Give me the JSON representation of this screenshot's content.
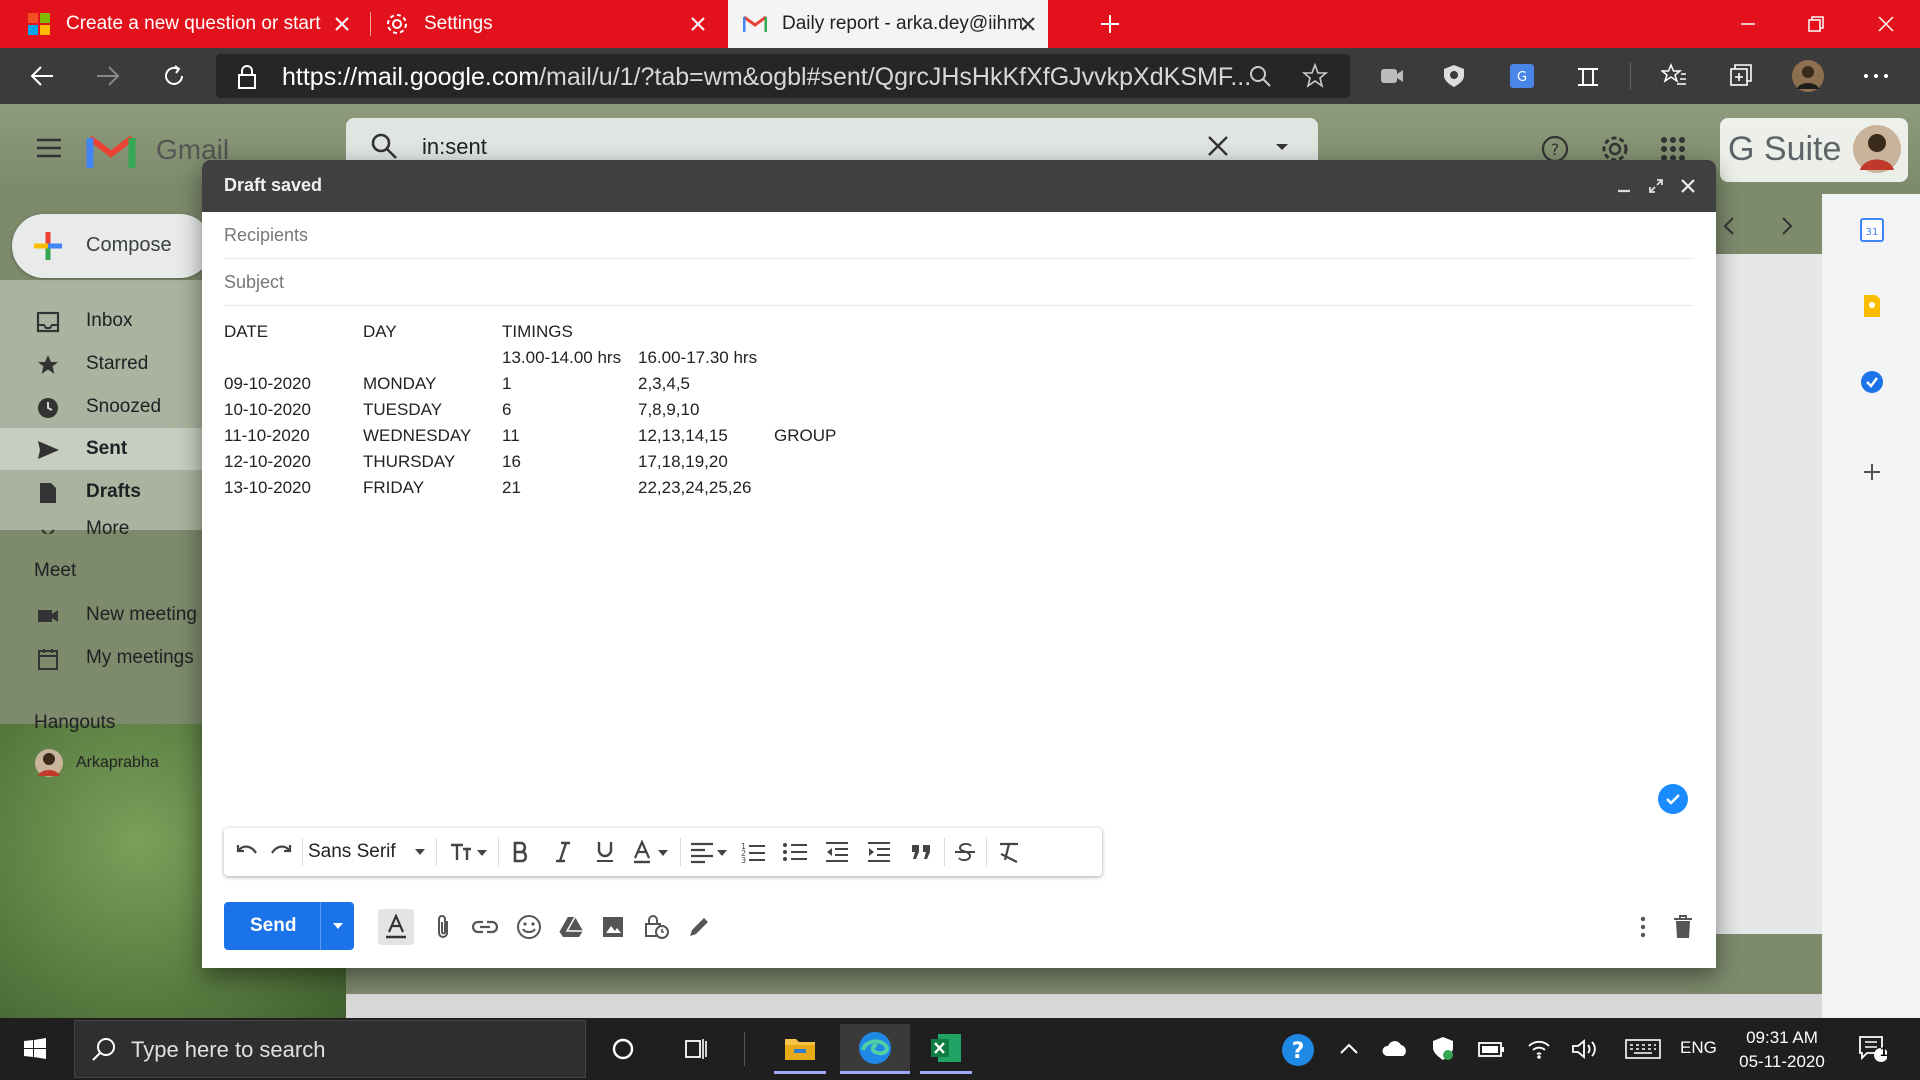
{
  "browser": {
    "tabs": [
      {
        "label": "Create a new question or start a",
        "icon": "microsoft-icon"
      },
      {
        "label": "Settings",
        "icon": "gear-icon"
      },
      {
        "label": "Daily report - arka.dey@iihm.ac.i",
        "icon": "gmail-icon",
        "active": true
      }
    ],
    "url_host": "https://mail.google.com",
    "url_path": "/mail/u/1/?tab=wm&ogbl#sent/QgrcJHsHkKfXfGJvvkpXdKSMF..."
  },
  "gmail": {
    "logo_text": "Gmail",
    "search_value": "in:sent",
    "gsuite_label": "G Suite",
    "compose_label": "Compose",
    "sidebar": [
      {
        "label": "Inbox",
        "icon": "inbox-icon"
      },
      {
        "label": "Starred",
        "icon": "star-icon"
      },
      {
        "label": "Snoozed",
        "icon": "clock-icon"
      },
      {
        "label": "Sent",
        "icon": "send-icon"
      },
      {
        "label": "Drafts",
        "icon": "draft-icon"
      },
      {
        "label": "More",
        "icon": "chevron-down-icon"
      }
    ],
    "meet_title": "Meet",
    "meet_items": [
      "New meeting",
      "My meetings"
    ],
    "hangouts_title": "Hangouts",
    "hangouts_user": "Arkaprabha"
  },
  "compose": {
    "title": "Draft saved",
    "recipients_placeholder": "Recipients",
    "subject_placeholder": "Subject",
    "table": {
      "headers": [
        "DATE",
        "DAY",
        "TIMINGS"
      ],
      "subheaders": [
        "13.00-14.00 hrs",
        "16.00-17.30 hrs"
      ],
      "rows": [
        [
          "09-10-2020",
          "MONDAY",
          "1",
          "2,3,4,5",
          ""
        ],
        [
          "10-10-2020",
          "TUESDAY",
          "6",
          "7,8,9,10",
          ""
        ],
        [
          "11-10-2020",
          "WEDNESDAY",
          "11",
          "12,13,14,15",
          "GROUP"
        ],
        [
          "12-10-2020",
          "THURSDAY",
          "16",
          "17,18,19,20",
          ""
        ],
        [
          "13-10-2020",
          "FRIDAY",
          "21",
          "22,23,24,25,26",
          ""
        ]
      ]
    },
    "font_name": "Sans Serif",
    "send_label": "Send"
  },
  "taskbar": {
    "search_placeholder": "Type here to search",
    "language": "ENG",
    "time": "09:31 AM",
    "date": "05-11-2020",
    "notification_count": "1"
  },
  "colors": {
    "tabbar": "#e3111c",
    "send_button": "#1a73e8",
    "compose_header": "#404040"
  }
}
